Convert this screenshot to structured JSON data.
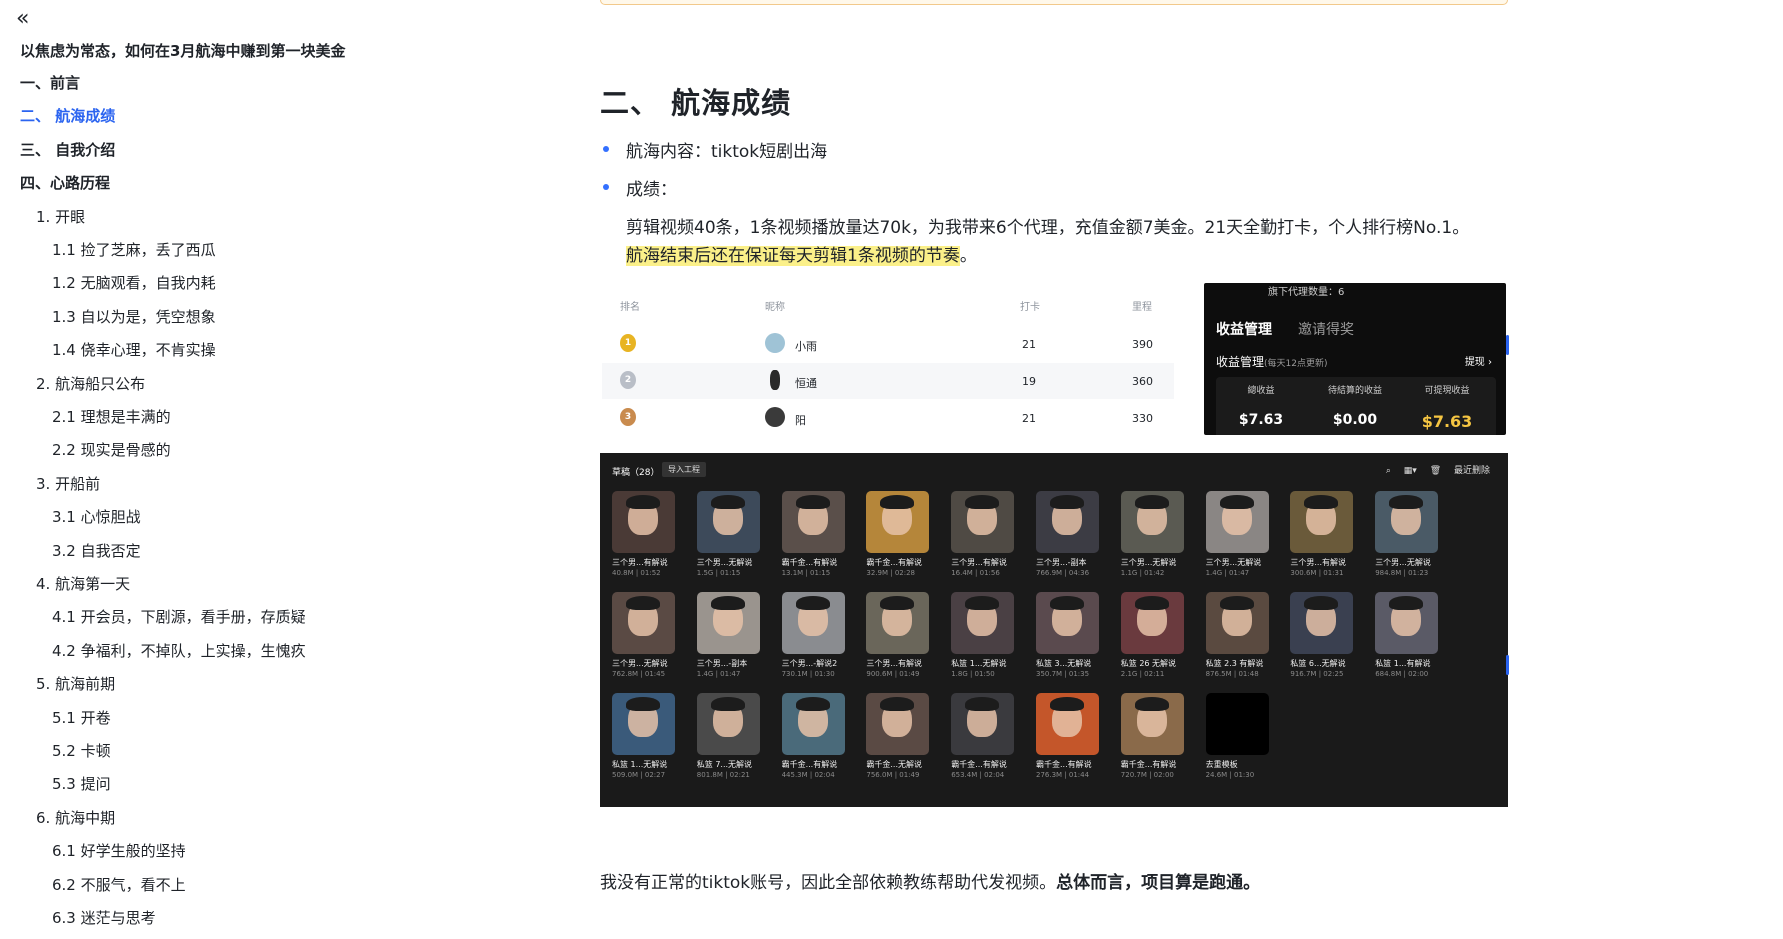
{
  "sidebar": {
    "collapse_icon": "«",
    "doc_title": "以焦虑为常态，如何在3月航海中赚到第一块美金",
    "toc": [
      {
        "label": "一、前言",
        "level": 1,
        "active": false
      },
      {
        "label": "二、 航海成绩",
        "level": 1,
        "active": true
      },
      {
        "label": "三、 自我介绍",
        "level": 1,
        "active": false
      },
      {
        "label": "四、心路历程",
        "level": 1,
        "active": false
      },
      {
        "label": "1. 开眼",
        "level": 2,
        "active": false
      },
      {
        "label": "1.1 捡了芝麻，丢了西瓜",
        "level": 3,
        "active": false
      },
      {
        "label": "1.2 无脑观看，自我内耗",
        "level": 3,
        "active": false
      },
      {
        "label": "1.3 自以为是，凭空想象",
        "level": 3,
        "active": false
      },
      {
        "label": "1.4 侥幸心理，不肯实操",
        "level": 3,
        "active": false
      },
      {
        "label": "2. 航海船只公布",
        "level": 2,
        "active": false
      },
      {
        "label": "2.1 理想是丰满的",
        "level": 3,
        "active": false
      },
      {
        "label": "2.2 现实是骨感的",
        "level": 3,
        "active": false
      },
      {
        "label": "3. 开船前",
        "level": 2,
        "active": false
      },
      {
        "label": "3.1 心惊胆战",
        "level": 3,
        "active": false
      },
      {
        "label": "3.2 自我否定",
        "level": 3,
        "active": false
      },
      {
        "label": "4. 航海第一天",
        "level": 2,
        "active": false
      },
      {
        "label": "4.1 开会员，下剧源，看手册，存质疑",
        "level": 3,
        "active": false
      },
      {
        "label": "4.2 争福利，不掉队，上实操，生愧疚",
        "level": 3,
        "active": false
      },
      {
        "label": "5. 航海前期",
        "level": 2,
        "active": false
      },
      {
        "label": "5.1 开卷",
        "level": 3,
        "active": false
      },
      {
        "label": "5.2 卡顿",
        "level": 3,
        "active": false
      },
      {
        "label": "5.3 提问",
        "level": 3,
        "active": false
      },
      {
        "label": "6. 航海中期",
        "level": 2,
        "active": false
      },
      {
        "label": "6.1 好学生般的坚持",
        "level": 3,
        "active": false
      },
      {
        "label": "6.2 不服气，看不上",
        "level": 3,
        "active": false
      },
      {
        "label": "6.3 迷茫与思考",
        "level": 3,
        "active": false
      }
    ]
  },
  "main": {
    "heading": "二、 航海成绩",
    "bullets": [
      {
        "text": "航海内容：tiktok短剧出海"
      },
      {
        "text": "成绩："
      }
    ],
    "para1": "剪辑视频40条，1条视频播放量达70k，为我带来6个代理，充值金额7美金。21天全勤打卡，个人排行榜No.1。",
    "para2_highlight": "航海结束后还在保证每天剪辑1条视频的节奏",
    "para2_tail": "。",
    "bottom_plain": "我没有正常的tiktok账号，因此全部依赖教练帮助代发视频。",
    "bottom_bold": "总体而言，项目算是跑通。"
  },
  "rank_table": {
    "headers": {
      "rank": "排名",
      "name": "昵称",
      "checkin": "打卡",
      "mileage": "里程"
    },
    "rows": [
      {
        "medal": "1",
        "name": "小雨",
        "checkin": "21",
        "mileage": "390",
        "medal_color": "#e8b423"
      },
      {
        "medal": "2",
        "name": "恒通",
        "checkin": "19",
        "mileage": "360",
        "medal_color": "#b9bec7"
      },
      {
        "medal": "3",
        "name": "阳",
        "checkin": "21",
        "mileage": "330",
        "medal_color": "#c98b4e"
      }
    ]
  },
  "earnings": {
    "agent_count_label": "旗下代理数量：6",
    "tab_active": "收益管理",
    "tab_inactive": "邀请得奖",
    "section_title": "收益管理",
    "section_note": "(每天12点更新)",
    "withdraw_label": "提现 ›",
    "cols": [
      {
        "label": "總收益",
        "value": "$7.63"
      },
      {
        "label": "待結算的收益",
        "value": "$0.00"
      },
      {
        "label": "可提現收益",
        "value": "$7.63"
      }
    ]
  },
  "gallery": {
    "header_label": "草稿（28）",
    "import_label": "导入工程",
    "tool_search_icon": "search-icon",
    "tool_view_icon": "grid-view-icon",
    "tool_delete_label": "最近删除",
    "items": [
      {
        "name": "三个男...有解说",
        "meta": "40.8M | 01:52",
        "color": "#4a3a36"
      },
      {
        "name": "三个男...无解说",
        "meta": "1.5G | 01:15",
        "color": "#3d4a5a"
      },
      {
        "name": "霸千金...有解说",
        "meta": "13.1M | 01:15",
        "color": "#5a4f4a"
      },
      {
        "name": "霸千金...有解说",
        "meta": "32.9M | 02:28",
        "color": "#b5863a"
      },
      {
        "name": "三个男...有解说",
        "meta": "16.4M | 01:56",
        "color": "#4f4a44"
      },
      {
        "name": "三个男...-副本",
        "meta": "766.9M | 04:36",
        "color": "#3c3c44"
      },
      {
        "name": "三个男...无解说",
        "meta": "1.1G | 01:42",
        "color": "#5a5a52"
      },
      {
        "name": "三个男...无解说",
        "meta": "1.4G | 01:47",
        "color": "#8a8684"
      },
      {
        "name": "三个男...有解说",
        "meta": "300.6M | 01:31",
        "color": "#6a5a3a"
      },
      {
        "name": "三个男...无解说",
        "meta": "984.8M | 01:23",
        "color": "#4a5a66"
      },
      {
        "name": "三个男...无解说",
        "meta": "762.8M | 01:45",
        "color": "#5a4a44"
      },
      {
        "name": "三个男...-副本",
        "meta": "1.4G | 01:47",
        "color": "#9a948e"
      },
      {
        "name": "三个男...-解说2",
        "meta": "730.1M | 01:30",
        "color": "#8a8c90"
      },
      {
        "name": "三个男...有解说",
        "meta": "900.6M | 01:49",
        "color": "#6a665a"
      },
      {
        "name": "私篮 1...无解说",
        "meta": "1.8G | 01:50",
        "color": "#4a4044"
      },
      {
        "name": "私篮 3...无解说",
        "meta": "350.7M | 01:35",
        "color": "#5a4a4e"
      },
      {
        "name": "私篮 26 无解说",
        "meta": "2.1G | 02:11",
        "color": "#6a3a3e"
      },
      {
        "name": "私篮 2.3 有解说",
        "meta": "876.5M | 01:48",
        "color": "#5a4a40"
      },
      {
        "name": "私篮 6...无解说",
        "meta": "916.7M | 02:25",
        "color": "#3a4050"
      },
      {
        "name": "私篮 1...有解说",
        "meta": "684.8M | 02:00",
        "color": "#5a5a66"
      },
      {
        "name": "私篮 1...无解说",
        "meta": "509.0M | 02:27",
        "color": "#3a5a7a"
      },
      {
        "name": "私篮 7...无解说",
        "meta": "801.8M | 02:21",
        "color": "#4a4a4a"
      },
      {
        "name": "霸千金...有解说",
        "meta": "445.3M | 02:04",
        "color": "#4a6a7a"
      },
      {
        "name": "霸千金...无解说",
        "meta": "756.0M | 01:49",
        "color": "#5a4a44"
      },
      {
        "name": "霸千金...有解说",
        "meta": "653.4M | 02:04",
        "color": "#3a3a3e"
      },
      {
        "name": "霸千金...有解说",
        "meta": "276.3M | 01:44",
        "color": "#c4562a"
      },
      {
        "name": "霸千金...有解说",
        "meta": "720.7M | 02:00",
        "color": "#8a6a4a"
      },
      {
        "name": "去重模板",
        "meta": "24.6M | 01:30",
        "color": "#000000"
      }
    ]
  }
}
